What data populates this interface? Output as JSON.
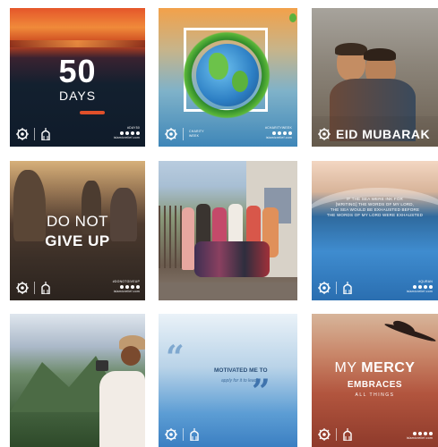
{
  "tiles": [
    {
      "id": "t1",
      "headline": "50",
      "sub": "DAYS",
      "tag": "#DAY50",
      "url": "islamicrelief.com"
    },
    {
      "id": "t2",
      "brand_small": "CHARITY WEEK",
      "tag": "#CHARITYWEEK",
      "url": "islamicrelief.com"
    },
    {
      "id": "t3",
      "headline": "EID MUBARAK"
    },
    {
      "id": "t4",
      "line1": "DO NOT",
      "line2": "GIVE UP",
      "tag": "#DONOTGIVEUP",
      "url": "islamicrelief.com"
    },
    {
      "id": "t5"
    },
    {
      "id": "t6",
      "q1": "IF THE SEA WERE INK FOR",
      "q2": "[WRITING] THE WORDS OF MY LORD,",
      "q3": "THE SEA WOULD BE EXHAUSTED BEFORE",
      "q4": "THE WORDS OF MY LORD WERE EXHAUSTED",
      "tag": "#QURAN",
      "url": "islamicrelief.com"
    },
    {
      "id": "t7"
    },
    {
      "id": "t8",
      "line_a": "MOTIVATED ME TO",
      "line_b": "apply for it to lead!"
    },
    {
      "id": "t9",
      "my": "MY",
      "mercy": "MERCY",
      "embraces": "EMBRACES",
      "all": "ALL THINGS",
      "url": "islamicrelief.com"
    }
  ],
  "icons": {
    "logo": "islamic-relief-logo-icon",
    "mosque": "mosque-icon"
  }
}
